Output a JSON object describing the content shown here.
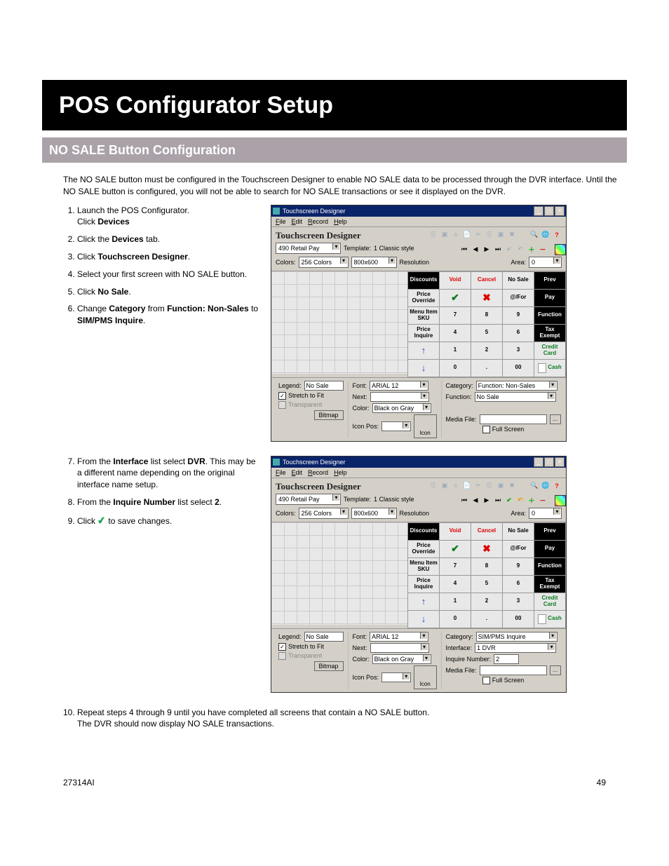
{
  "banners": {
    "black": "POS Configurator Setup",
    "gray": "NO SALE Button Configuration"
  },
  "intro": "The NO SALE button must be configured in the Touchscreen Designer to enable NO SALE data to be processed through the DVR interface. Until the NO SALE button is configured, you will not be able to search for NO SALE transactions or see it displayed on the DVR.",
  "steps": {
    "s1a": "Launch the POS Configurator.",
    "s1b_prefix": "Click ",
    "s1b_bold": "Devices",
    "s2_prefix": "Click the ",
    "s2_bold": "Devices",
    "s2_suffix": " tab.",
    "s3_prefix": "Click ",
    "s3_bold": "Touchscreen Designer",
    "s3_suffix": ".",
    "s4": "Select your first screen with NO SALE button.",
    "s5_prefix": "Click ",
    "s5_bold": "No Sale",
    "s5_suffix": ".",
    "s6_prefix": "Change ",
    "s6_bold1": "Category",
    "s6_mid1": " from ",
    "s6_bold2": "Function: Non-Sales",
    "s6_mid2": " to ",
    "s6_bold3": "SIM/PMS Inquire",
    "s6_suffix": ".",
    "s7_prefix": "From the ",
    "s7_bold1": "Interface",
    "s7_mid": " list select ",
    "s7_bold2": "DVR",
    "s7_suffix": ". This may be a different name depending on the original interface name setup.",
    "s8_prefix": "From the ",
    "s8_bold1": "Inquire Number",
    "s8_mid": " list select ",
    "s8_bold2": "2",
    "s8_suffix": ".",
    "s9_prefix": "Click ",
    "s9_suffix": " to save changes.",
    "s10a": "Repeat steps 4 through 9 until you have completed all screens that contain a NO SALE button.",
    "s10b": "The DVR should now display NO SALE transactions."
  },
  "footer": {
    "left": "27314AI",
    "right": "49"
  },
  "window": {
    "title": "Touchscreen Designer",
    "menu": [
      "File",
      "Edit",
      "Record",
      "Help"
    ],
    "app_title": "Touchscreen Designer",
    "record_select": "490 Retail Pay",
    "colors_label": "Colors:",
    "colors_value": "256 Colors",
    "template_label": "Template:",
    "template_value": "1 Classic style",
    "res_value": "800x600",
    "res_label": "Resolution",
    "area_label": "Area:",
    "area_value": "0",
    "buttons": [
      {
        "label": "Discounts",
        "cls": "dark"
      },
      {
        "label": "Void",
        "cls": "red"
      },
      {
        "label": "Cancel",
        "cls": "red"
      },
      {
        "label": "No Sale",
        "cls": ""
      },
      {
        "label": "Prev",
        "cls": "dark"
      },
      {
        "label": "Price Override",
        "cls": ""
      },
      {
        "label": "✓",
        "cls": "green"
      },
      {
        "label": "✗",
        "cls": "red"
      },
      {
        "label": "@/For",
        "cls": ""
      },
      {
        "label": "Pay",
        "cls": "dark"
      },
      {
        "label": "Menu Item SKU",
        "cls": ""
      },
      {
        "label": "7",
        "cls": ""
      },
      {
        "label": "8",
        "cls": ""
      },
      {
        "label": "9",
        "cls": ""
      },
      {
        "label": "Function",
        "cls": "dark"
      },
      {
        "label": "Price Inquire",
        "cls": ""
      },
      {
        "label": "4",
        "cls": ""
      },
      {
        "label": "5",
        "cls": ""
      },
      {
        "label": "6",
        "cls": ""
      },
      {
        "label": "Tax Exempt",
        "cls": "dark"
      },
      {
        "label": "↑",
        "cls": "blue-arrow"
      },
      {
        "label": "1",
        "cls": ""
      },
      {
        "label": "2",
        "cls": ""
      },
      {
        "label": "3",
        "cls": ""
      },
      {
        "label": "Credit Card",
        "cls": "green"
      },
      {
        "label": "↓",
        "cls": "blue-arrow"
      },
      {
        "label": "0",
        "cls": ""
      },
      {
        "label": ".",
        "cls": ""
      },
      {
        "label": "00",
        "cls": ""
      },
      {
        "label": "Cash",
        "cls": "green",
        "icon": true
      }
    ],
    "props_common": {
      "legend_label": "Legend:",
      "legend_value": "No Sale",
      "stretch": "Stretch to Fit",
      "transparent": "Transparent",
      "bitmap": "Bitmap",
      "font_label": "Font:",
      "font_value": "ARIAL 12",
      "next_label": "Next:",
      "color_label": "Color:",
      "color_value": "Black on Gray",
      "iconpos_label": "Icon Pos:",
      "icon_label": "Icon",
      "category_label": "Category:",
      "media_label": "Media File:",
      "fullscreen": "Full Screen"
    },
    "props_shot1": {
      "category_value": "Function: Non-Sales",
      "function_label": "Function:",
      "function_value": "No Sale"
    },
    "props_shot2": {
      "category_value": "SIM/PMS Inquire",
      "interface_label": "Interface:",
      "interface_value": "1 DVR",
      "inquire_label": "Inquire Number:",
      "inquire_value": "2"
    }
  }
}
